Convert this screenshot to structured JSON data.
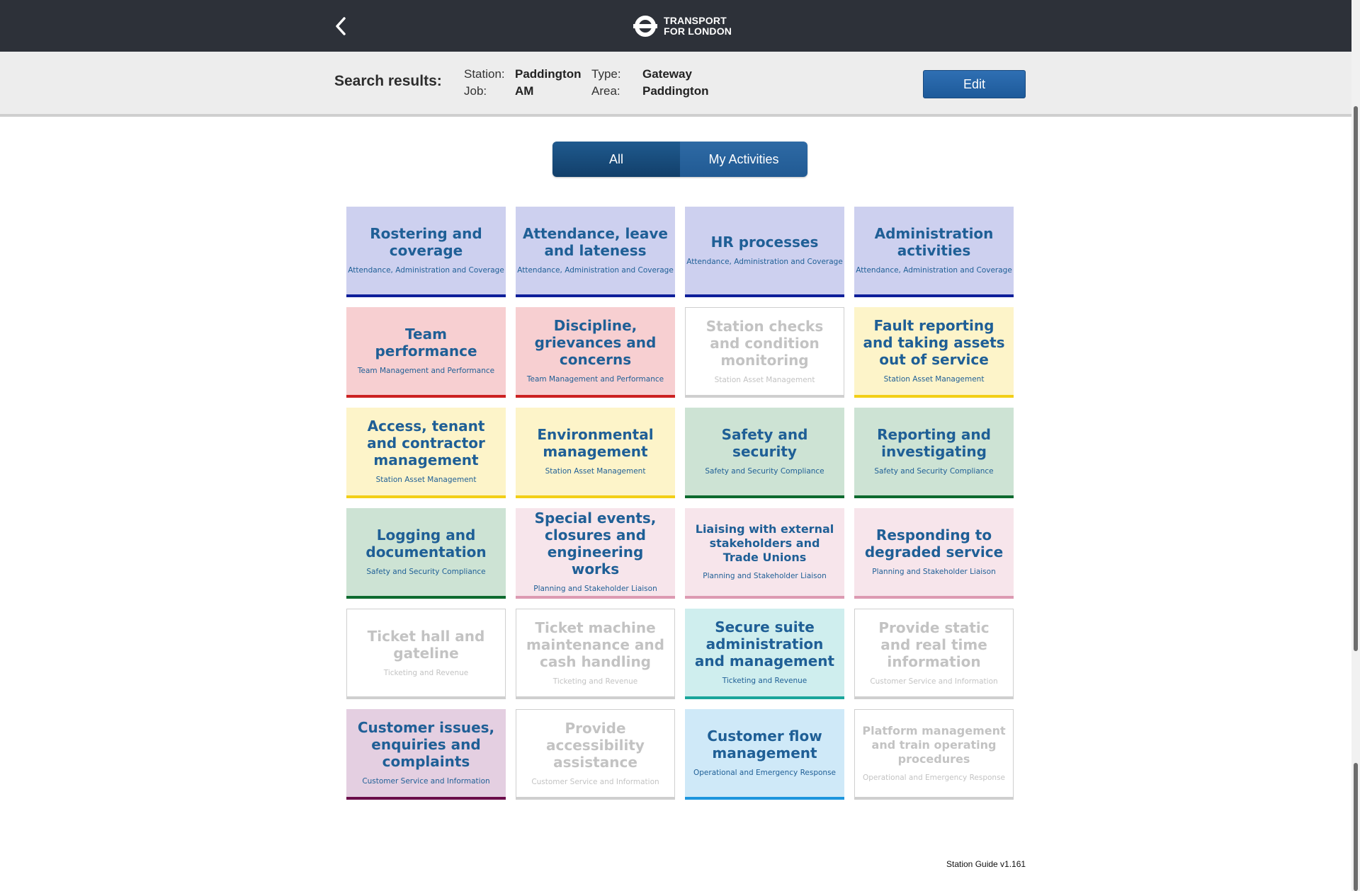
{
  "header": {
    "back_icon": "chevron-left-icon",
    "logo_icon": "tfl-roundel-icon",
    "logo_line1": "TRANSPORT",
    "logo_line2": "FOR LONDON"
  },
  "search": {
    "title": "Search results:",
    "station_label": "Station:",
    "station_value": "Paddington",
    "job_label": "Job:",
    "job_value": "AM",
    "type_label": "Type:",
    "type_value": "Gateway",
    "area_label": "Area:",
    "area_value": "Paddington",
    "edit_label": "Edit"
  },
  "toggle": {
    "all_label": "All",
    "mine_label": "My Activities",
    "active": "All"
  },
  "cards": [
    {
      "title": "Rostering and coverage",
      "subtitle": "Attendance, Administration and Coverage",
      "color": "blue",
      "enabled": true
    },
    {
      "title": "Attendance, leave and lateness",
      "subtitle": "Attendance, Administration and Coverage",
      "color": "blue",
      "enabled": true
    },
    {
      "title": "HR processes",
      "subtitle": "Attendance, Administration and Coverage",
      "color": "blue",
      "enabled": true
    },
    {
      "title": "Administration activities",
      "subtitle": "Attendance, Administration and Coverage",
      "color": "blue",
      "enabled": true
    },
    {
      "title": "Team performance",
      "subtitle": "Team Management and Performance",
      "color": "red",
      "enabled": true
    },
    {
      "title": "Discipline, grievances and concerns",
      "subtitle": "Team Management and Performance",
      "color": "red",
      "enabled": true
    },
    {
      "title": "Station checks and condition monitoring",
      "subtitle": "Station Asset Management",
      "color": "grey",
      "enabled": false
    },
    {
      "title": "Fault reporting and taking assets out of service",
      "subtitle": "Station Asset Management",
      "color": "yellow",
      "enabled": true
    },
    {
      "title": "Access, tenant and contractor management",
      "subtitle": "Station Asset Management",
      "color": "yellow",
      "enabled": true
    },
    {
      "title": "Environmental management",
      "subtitle": "Station Asset Management",
      "color": "yellow",
      "enabled": true
    },
    {
      "title": "Safety and security",
      "subtitle": "Safety and Security Compliance",
      "color": "green",
      "enabled": true
    },
    {
      "title": "Reporting and investigating",
      "subtitle": "Safety and Security Compliance",
      "color": "green",
      "enabled": true
    },
    {
      "title": "Logging and documentation",
      "subtitle": "Safety and Security Compliance",
      "color": "green",
      "enabled": true
    },
    {
      "title": "Special events, closures and engineering works",
      "subtitle": "Planning and Stakeholder Liaison",
      "color": "pink",
      "enabled": true
    },
    {
      "title": "Liaising with external stakeholders and Trade Unions",
      "subtitle": "Planning and Stakeholder Liaison",
      "color": "pink",
      "enabled": true,
      "small": true
    },
    {
      "title": "Responding to degraded service",
      "subtitle": "Planning and Stakeholder Liaison",
      "color": "pink",
      "enabled": true
    },
    {
      "title": "Ticket hall and gateline",
      "subtitle": "Ticketing and Revenue",
      "color": "grey",
      "enabled": false
    },
    {
      "title": "Ticket machine maintenance and cash handling",
      "subtitle": "Ticketing and Revenue",
      "color": "grey",
      "enabled": false
    },
    {
      "title": "Secure suite administration and management",
      "subtitle": "Ticketing and Revenue",
      "color": "teal",
      "enabled": true
    },
    {
      "title": "Provide static and real time information",
      "subtitle": "Customer Service and Information",
      "color": "grey",
      "enabled": false
    },
    {
      "title": "Customer issues, enquiries and complaints",
      "subtitle": "Customer Service and Information",
      "color": "purple",
      "enabled": true
    },
    {
      "title": "Provide accessibility assistance",
      "subtitle": "Customer Service and Information",
      "color": "grey",
      "enabled": false
    },
    {
      "title": "Customer flow management",
      "subtitle": "Operational and Emergency Response",
      "color": "sky",
      "enabled": true
    },
    {
      "title": "Platform management and train operating procedures",
      "subtitle": "Operational and Emergency Response",
      "color": "grey",
      "enabled": false,
      "small": true
    }
  ],
  "footer": {
    "version": "Station Guide v1.161"
  }
}
